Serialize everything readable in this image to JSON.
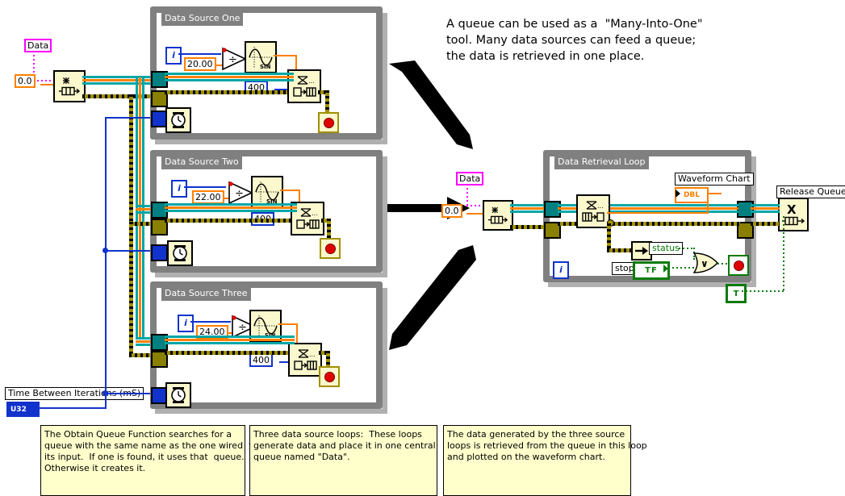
{
  "headline": {
    "lines": [
      "A queue can be used as a  \"Many-Into-One\"",
      "tool. Many data sources can feed a queue;",
      "the data is retrieved in one place."
    ]
  },
  "left_column": {
    "queue_name_constant": "Data",
    "size_constant": "0.0",
    "obtain_queue_icon": "obtain-queue-icon",
    "timing_label": "Time Between Iterations (mS)",
    "timing_terminal_type": "U32"
  },
  "source_loops": [
    {
      "title": "Data Source One",
      "iteration_terminal": "i",
      "divisor_constant": "20.00",
      "sine_icon": "sine-function-icon",
      "divide_icon": "divide-function-icon",
      "timeout_constant": "400",
      "enqueue_icon": "enqueue-element-icon",
      "wait_icon": "wait-ms-icon",
      "stop_icon": "stop-button-icon"
    },
    {
      "title": "Data Source Two",
      "iteration_terminal": "i",
      "divisor_constant": "22.00",
      "sine_icon": "sine-function-icon",
      "divide_icon": "divide-function-icon",
      "timeout_constant": "400",
      "enqueue_icon": "enqueue-element-icon",
      "wait_icon": "wait-ms-icon",
      "stop_icon": "stop-button-icon"
    },
    {
      "title": "Data Source Three",
      "iteration_terminal": "i",
      "divisor_constant": "24.00",
      "sine_icon": "sine-function-icon",
      "divide_icon": "divide-function-icon",
      "timeout_constant": "400",
      "enqueue_icon": "enqueue-element-icon",
      "wait_icon": "wait-ms-icon",
      "stop_icon": "stop-button-icon"
    }
  ],
  "retrieval": {
    "queue_name_constant": "Data",
    "size_constant": "0.0",
    "obtain_queue_icon": "obtain-queue-icon",
    "loop_title": "Data Retrieval Loop",
    "iteration_terminal": "i",
    "dequeue_icon": "dequeue-element-icon",
    "chart_label": "Waveform Chart",
    "chart_terminal_type": "DBL",
    "status_label": "status",
    "stop_label": "stop",
    "stop_terminal_value": "TF",
    "or_icon": "or-function-icon",
    "stop_icon": "stop-button-icon",
    "true_constant": "T",
    "release_queue_label": "Release Queue",
    "release_queue_icon": "release-queue-icon"
  },
  "notes": [
    {
      "name": "note-obtain-queue",
      "lines": [
        "The Obtain Queue Function searches for a",
        "queue with the same name as the one wired  to",
        "its input.  If one is found, it uses that  queue.",
        "Otherwise it creates it."
      ]
    },
    {
      "name": "note-three-sources",
      "lines": [
        "Three data source loops:  These loops",
        "generate data and place it in one central",
        "queue named \"Data\"."
      ]
    },
    {
      "name": "note-retrieval",
      "lines": [
        "The data generated by the three source",
        "loops is retrieved from the queue in this loop",
        "and plotted on the waveform chart."
      ]
    }
  ],
  "colors": {
    "structure_border": "#808080",
    "wire_teal": "#00a6a6",
    "wire_orange": "#ff8000",
    "wire_blue": "#1133cc",
    "wire_magenta": "#ff00ff",
    "wire_error": "#a09000",
    "wire_boolean": "#0a7a0a",
    "node_fill": "#fbf8cd",
    "note_fill": "#ffffcc"
  }
}
